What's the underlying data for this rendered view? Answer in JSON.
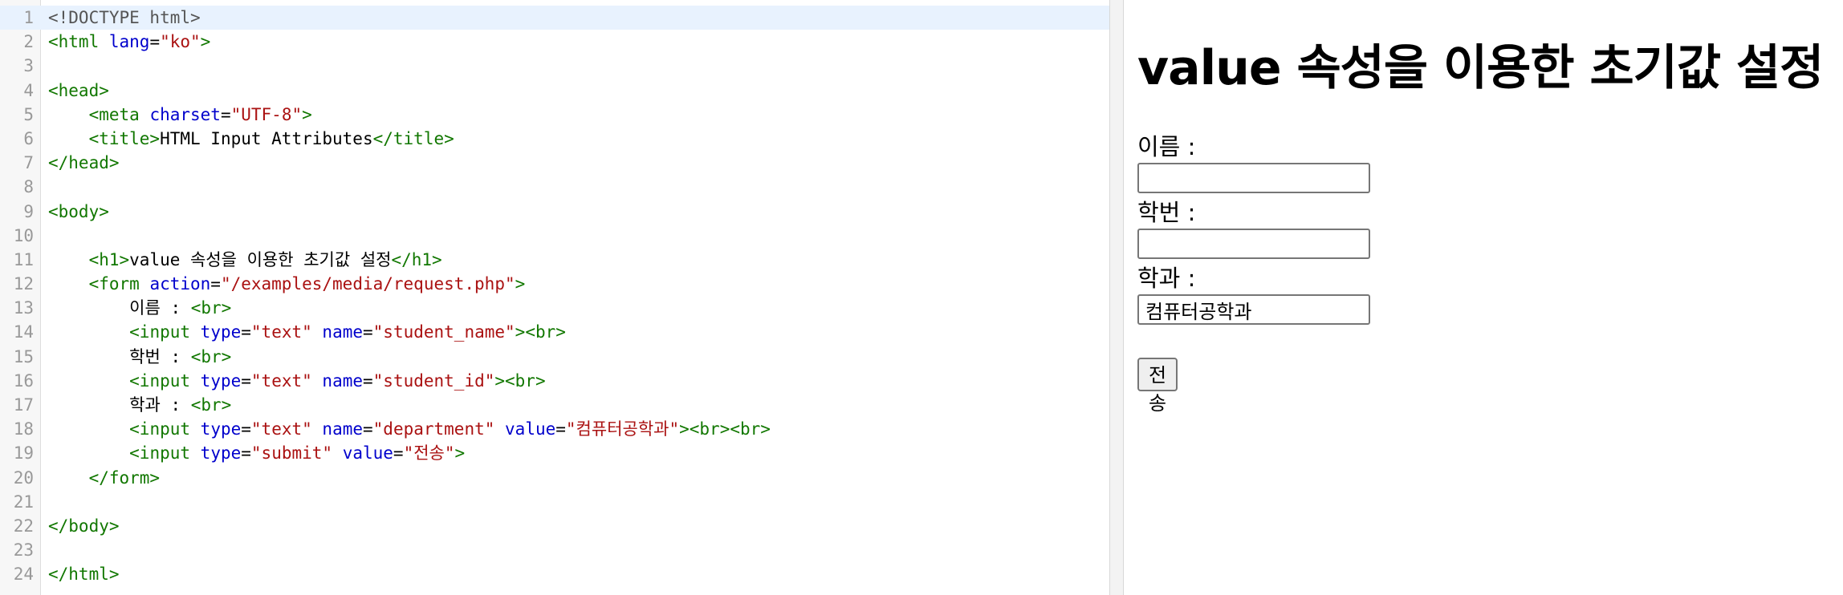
{
  "editor": {
    "lines": [
      [
        [
          "meta",
          "<!DOCTYPE html>"
        ]
      ],
      [
        [
          "tag",
          "<html "
        ],
        [
          "attr",
          "lang"
        ],
        [
          "plain",
          "="
        ],
        [
          "str",
          "\"ko\""
        ],
        [
          "tag",
          ">"
        ]
      ],
      [],
      [
        [
          "tag",
          "<head>"
        ]
      ],
      [
        [
          "plain",
          "    "
        ],
        [
          "tag",
          "<meta "
        ],
        [
          "attr",
          "charset"
        ],
        [
          "plain",
          "="
        ],
        [
          "str",
          "\"UTF-8\""
        ],
        [
          "tag",
          ">"
        ]
      ],
      [
        [
          "plain",
          "    "
        ],
        [
          "tag",
          "<title>"
        ],
        [
          "text",
          "HTML Input Attributes"
        ],
        [
          "tag",
          "</title>"
        ]
      ],
      [
        [
          "tag",
          "</head>"
        ]
      ],
      [],
      [
        [
          "tag",
          "<body>"
        ]
      ],
      [],
      [
        [
          "plain",
          "    "
        ],
        [
          "tag",
          "<h1>"
        ],
        [
          "text",
          "value 속성을 이용한 초기값 설정"
        ],
        [
          "tag",
          "</h1>"
        ]
      ],
      [
        [
          "plain",
          "    "
        ],
        [
          "tag",
          "<form "
        ],
        [
          "attr",
          "action"
        ],
        [
          "plain",
          "="
        ],
        [
          "str",
          "\"/examples/media/request.php\""
        ],
        [
          "tag",
          ">"
        ]
      ],
      [
        [
          "plain",
          "        "
        ],
        [
          "text",
          "이름 : "
        ],
        [
          "tag",
          "<br>"
        ]
      ],
      [
        [
          "plain",
          "        "
        ],
        [
          "tag",
          "<input "
        ],
        [
          "attr",
          "type"
        ],
        [
          "plain",
          "="
        ],
        [
          "str",
          "\"text\" "
        ],
        [
          "attr",
          "name"
        ],
        [
          "plain",
          "="
        ],
        [
          "str",
          "\"student_name\""
        ],
        [
          "tag",
          "><br>"
        ]
      ],
      [
        [
          "plain",
          "        "
        ],
        [
          "text",
          "학번 : "
        ],
        [
          "tag",
          "<br>"
        ]
      ],
      [
        [
          "plain",
          "        "
        ],
        [
          "tag",
          "<input "
        ],
        [
          "attr",
          "type"
        ],
        [
          "plain",
          "="
        ],
        [
          "str",
          "\"text\" "
        ],
        [
          "attr",
          "name"
        ],
        [
          "plain",
          "="
        ],
        [
          "str",
          "\"student_id\""
        ],
        [
          "tag",
          "><br>"
        ]
      ],
      [
        [
          "plain",
          "        "
        ],
        [
          "text",
          "학과 : "
        ],
        [
          "tag",
          "<br>"
        ]
      ],
      [
        [
          "plain",
          "        "
        ],
        [
          "tag",
          "<input "
        ],
        [
          "attr",
          "type"
        ],
        [
          "plain",
          "="
        ],
        [
          "str",
          "\"text\" "
        ],
        [
          "attr",
          "name"
        ],
        [
          "plain",
          "="
        ],
        [
          "str",
          "\"department\" "
        ],
        [
          "attr",
          "value"
        ],
        [
          "plain",
          "="
        ],
        [
          "str",
          "\"컴퓨터공학과\""
        ],
        [
          "tag",
          "><br><br>"
        ]
      ],
      [
        [
          "plain",
          "        "
        ],
        [
          "tag",
          "<input "
        ],
        [
          "attr",
          "type"
        ],
        [
          "plain",
          "="
        ],
        [
          "str",
          "\"submit\" "
        ],
        [
          "attr",
          "value"
        ],
        [
          "plain",
          "="
        ],
        [
          "str",
          "\"전송\""
        ],
        [
          "tag",
          ">"
        ]
      ],
      [
        [
          "plain",
          "    "
        ],
        [
          "tag",
          "</form>"
        ]
      ],
      [],
      [
        [
          "tag",
          "</body>"
        ]
      ],
      [],
      [
        [
          "tag",
          "</html>"
        ]
      ]
    ],
    "active_line": 1,
    "colors": {
      "tag": "#117700",
      "attr": "#0000cc",
      "string": "#aa1111",
      "meta": "#555555",
      "active_line_bg": "#e8f2fe"
    }
  },
  "preview": {
    "heading": "value 속성을 이용한 초기값 설정",
    "form": {
      "name_label": "이름 :",
      "name_value": "",
      "id_label": "학번 :",
      "id_value": "",
      "department_label": "학과 :",
      "department_value": "컴퓨터공학과",
      "submit_label": "전송"
    }
  }
}
